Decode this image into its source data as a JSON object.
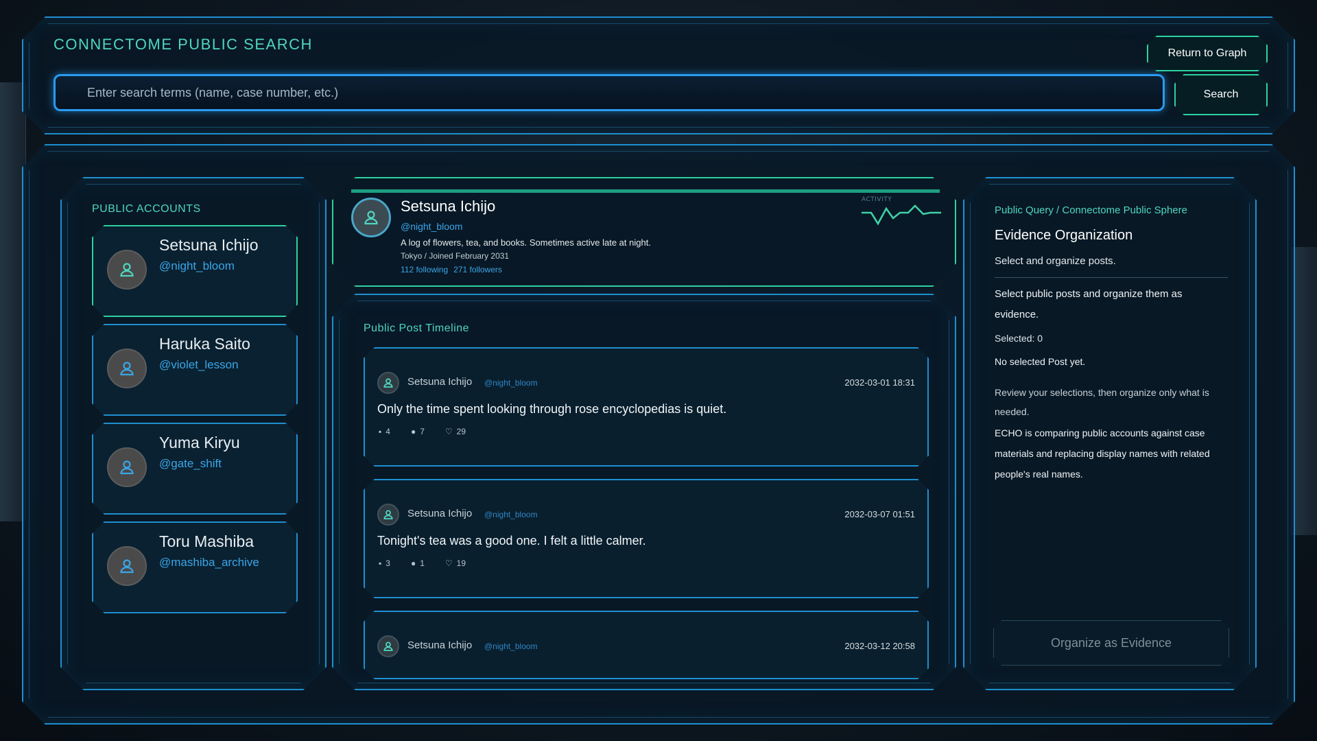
{
  "header": {
    "title": "CONNECTOME PUBLIC SEARCH",
    "search_placeholder": "Enter search terms (name, case number, etc.)",
    "return_label": "Return to Graph",
    "search_label": "Search"
  },
  "accounts": {
    "heading": "PUBLIC ACCOUNTS",
    "items": [
      {
        "name": "Setsuna Ichijo",
        "handle": "@night_bloom",
        "active": true
      },
      {
        "name": "Haruka Saito",
        "handle": "@violet_lesson",
        "active": false
      },
      {
        "name": "Yuma Kiryu",
        "handle": "@gate_shift",
        "active": false
      },
      {
        "name": "Toru Mashiba",
        "handle": "@mashiba_archive",
        "active": false
      }
    ]
  },
  "profile": {
    "name": "Setsuna Ichijo",
    "handle": "@night_bloom",
    "bio": "A log of flowers, tea, and books. Sometimes active late at night.",
    "meta": "Tokyo / Joined February 2031",
    "following": "112 following",
    "followers": "271 followers",
    "activity_label": "ACTIVITY"
  },
  "timeline": {
    "heading": "Public Post Timeline",
    "posts": [
      {
        "author": "Setsuna Ichijo",
        "handle": "@night_bloom",
        "date": "2032-03-01 18:31",
        "text": "Only the time spent looking through rose encyclopedias is quiet.",
        "replies": "4",
        "reposts": "7",
        "likes": "29"
      },
      {
        "author": "Setsuna Ichijo",
        "handle": "@night_bloom",
        "date": "2032-03-07 01:51",
        "text": "Tonight's tea was a good one. I felt a little calmer.",
        "replies": "3",
        "reposts": "1",
        "likes": "19"
      },
      {
        "author": "Setsuna Ichijo",
        "handle": "@night_bloom",
        "date": "2032-03-12 20:58"
      }
    ]
  },
  "evidence": {
    "breadcrumb": "Public Query / Connectome Public Sphere",
    "title": "Evidence Organization",
    "subtitle": "Select and organize posts.",
    "instruction": "Select public posts and organize them as evidence.",
    "selected": "Selected: 0",
    "empty": "No selected Post yet.",
    "review": "Review your selections, then organize only what is needed.",
    "echo": "ECHO is comparing public accounts against case materials and replacing display names with related people's real names.",
    "button_label": "Organize as Evidence"
  },
  "colors": {
    "accent_teal": "#2fd1a0",
    "accent_blue": "#1f8fd0",
    "link_blue": "#3aa6e8"
  },
  "icons": {
    "avatar": "user-icon",
    "replies": "comment-icon",
    "reposts": "repost-icon",
    "likes": "heart-icon"
  }
}
